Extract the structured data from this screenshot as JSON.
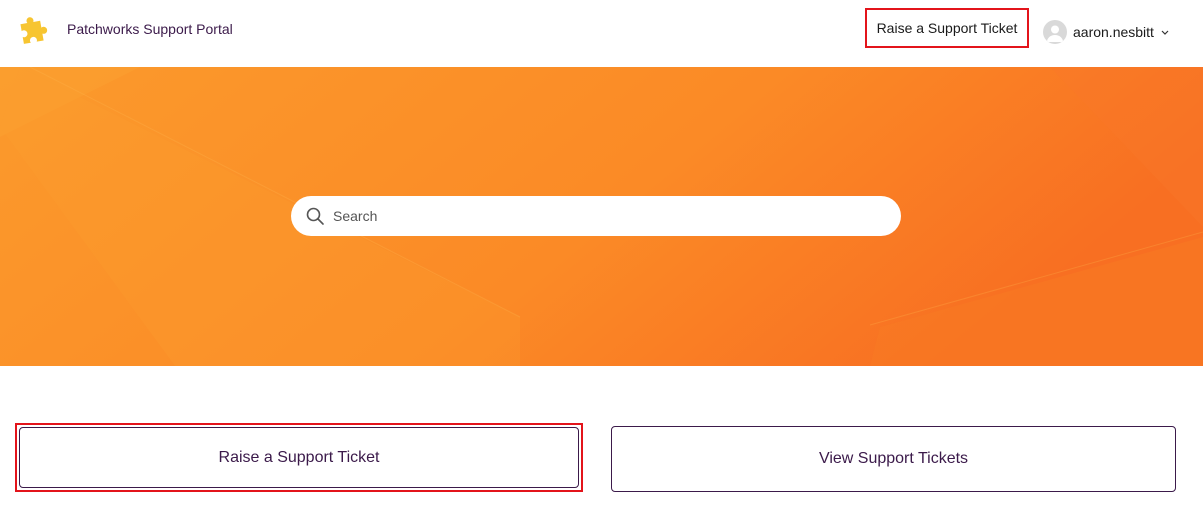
{
  "header": {
    "logo_icon": "puzzle-piece-icon",
    "portal_title": "Patchworks Support Portal",
    "raise_ticket_link": "Raise a Support Ticket",
    "user": {
      "name": "aaron.nesbitt",
      "avatar_icon": "user-avatar-icon",
      "menu_icon": "chevron-down-icon"
    }
  },
  "hero": {
    "search": {
      "placeholder": "Search",
      "value": "",
      "icon": "search-icon"
    }
  },
  "actions": {
    "raise_ticket_label": "Raise a Support Ticket",
    "view_tickets_label": "View Support Tickets"
  },
  "colors": {
    "brand_orange": "#fb8a26",
    "text_purple": "#3b1a4a",
    "highlight_red": "#e3141b",
    "logo_yellow": "#f7c531"
  }
}
